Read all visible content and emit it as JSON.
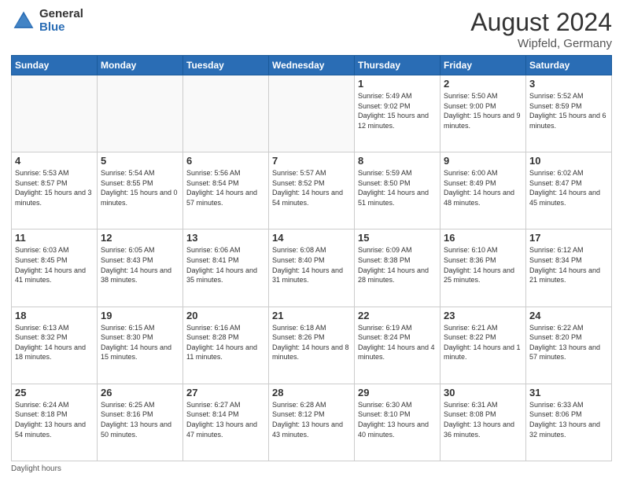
{
  "header": {
    "logo_general": "General",
    "logo_blue": "Blue",
    "title": "August 2024",
    "location": "Wipfeld, Germany"
  },
  "days": [
    "Sunday",
    "Monday",
    "Tuesday",
    "Wednesday",
    "Thursday",
    "Friday",
    "Saturday"
  ],
  "footer": "Daylight hours",
  "weeks": [
    [
      {
        "date": "",
        "sunrise": "",
        "sunset": "",
        "daylight": ""
      },
      {
        "date": "",
        "sunrise": "",
        "sunset": "",
        "daylight": ""
      },
      {
        "date": "",
        "sunrise": "",
        "sunset": "",
        "daylight": ""
      },
      {
        "date": "",
        "sunrise": "",
        "sunset": "",
        "daylight": ""
      },
      {
        "date": "1",
        "sunrise": "5:49 AM",
        "sunset": "9:02 PM",
        "daylight": "15 hours and 12 minutes."
      },
      {
        "date": "2",
        "sunrise": "5:50 AM",
        "sunset": "9:00 PM",
        "daylight": "15 hours and 9 minutes."
      },
      {
        "date": "3",
        "sunrise": "5:52 AM",
        "sunset": "8:59 PM",
        "daylight": "15 hours and 6 minutes."
      }
    ],
    [
      {
        "date": "4",
        "sunrise": "5:53 AM",
        "sunset": "8:57 PM",
        "daylight": "15 hours and 3 minutes."
      },
      {
        "date": "5",
        "sunrise": "5:54 AM",
        "sunset": "8:55 PM",
        "daylight": "15 hours and 0 minutes."
      },
      {
        "date": "6",
        "sunrise": "5:56 AM",
        "sunset": "8:54 PM",
        "daylight": "14 hours and 57 minutes."
      },
      {
        "date": "7",
        "sunrise": "5:57 AM",
        "sunset": "8:52 PM",
        "daylight": "14 hours and 54 minutes."
      },
      {
        "date": "8",
        "sunrise": "5:59 AM",
        "sunset": "8:50 PM",
        "daylight": "14 hours and 51 minutes."
      },
      {
        "date": "9",
        "sunrise": "6:00 AM",
        "sunset": "8:49 PM",
        "daylight": "14 hours and 48 minutes."
      },
      {
        "date": "10",
        "sunrise": "6:02 AM",
        "sunset": "8:47 PM",
        "daylight": "14 hours and 45 minutes."
      }
    ],
    [
      {
        "date": "11",
        "sunrise": "6:03 AM",
        "sunset": "8:45 PM",
        "daylight": "14 hours and 41 minutes."
      },
      {
        "date": "12",
        "sunrise": "6:05 AM",
        "sunset": "8:43 PM",
        "daylight": "14 hours and 38 minutes."
      },
      {
        "date": "13",
        "sunrise": "6:06 AM",
        "sunset": "8:41 PM",
        "daylight": "14 hours and 35 minutes."
      },
      {
        "date": "14",
        "sunrise": "6:08 AM",
        "sunset": "8:40 PM",
        "daylight": "14 hours and 31 minutes."
      },
      {
        "date": "15",
        "sunrise": "6:09 AM",
        "sunset": "8:38 PM",
        "daylight": "14 hours and 28 minutes."
      },
      {
        "date": "16",
        "sunrise": "6:10 AM",
        "sunset": "8:36 PM",
        "daylight": "14 hours and 25 minutes."
      },
      {
        "date": "17",
        "sunrise": "6:12 AM",
        "sunset": "8:34 PM",
        "daylight": "14 hours and 21 minutes."
      }
    ],
    [
      {
        "date": "18",
        "sunrise": "6:13 AM",
        "sunset": "8:32 PM",
        "daylight": "14 hours and 18 minutes."
      },
      {
        "date": "19",
        "sunrise": "6:15 AM",
        "sunset": "8:30 PM",
        "daylight": "14 hours and 15 minutes."
      },
      {
        "date": "20",
        "sunrise": "6:16 AM",
        "sunset": "8:28 PM",
        "daylight": "14 hours and 11 minutes."
      },
      {
        "date": "21",
        "sunrise": "6:18 AM",
        "sunset": "8:26 PM",
        "daylight": "14 hours and 8 minutes."
      },
      {
        "date": "22",
        "sunrise": "6:19 AM",
        "sunset": "8:24 PM",
        "daylight": "14 hours and 4 minutes."
      },
      {
        "date": "23",
        "sunrise": "6:21 AM",
        "sunset": "8:22 PM",
        "daylight": "14 hours and 1 minute."
      },
      {
        "date": "24",
        "sunrise": "6:22 AM",
        "sunset": "8:20 PM",
        "daylight": "13 hours and 57 minutes."
      }
    ],
    [
      {
        "date": "25",
        "sunrise": "6:24 AM",
        "sunset": "8:18 PM",
        "daylight": "13 hours and 54 minutes."
      },
      {
        "date": "26",
        "sunrise": "6:25 AM",
        "sunset": "8:16 PM",
        "daylight": "13 hours and 50 minutes."
      },
      {
        "date": "27",
        "sunrise": "6:27 AM",
        "sunset": "8:14 PM",
        "daylight": "13 hours and 47 minutes."
      },
      {
        "date": "28",
        "sunrise": "6:28 AM",
        "sunset": "8:12 PM",
        "daylight": "13 hours and 43 minutes."
      },
      {
        "date": "29",
        "sunrise": "6:30 AM",
        "sunset": "8:10 PM",
        "daylight": "13 hours and 40 minutes."
      },
      {
        "date": "30",
        "sunrise": "6:31 AM",
        "sunset": "8:08 PM",
        "daylight": "13 hours and 36 minutes."
      },
      {
        "date": "31",
        "sunrise": "6:33 AM",
        "sunset": "8:06 PM",
        "daylight": "13 hours and 32 minutes."
      }
    ]
  ]
}
